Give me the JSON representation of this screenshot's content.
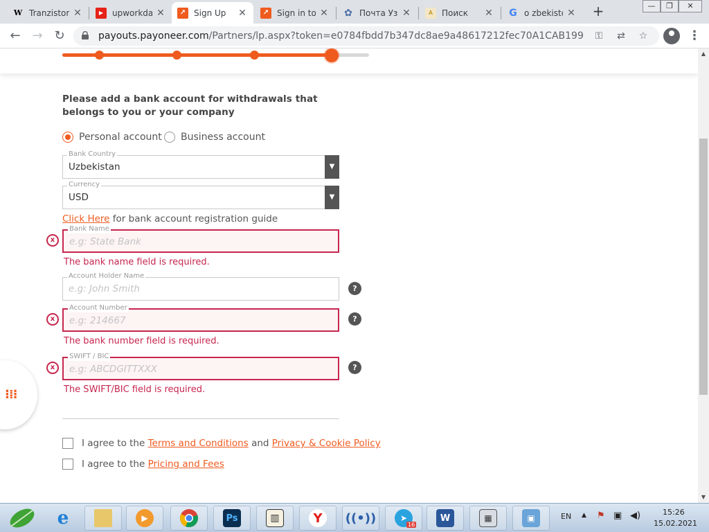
{
  "browser": {
    "tabs": [
      {
        "title": "Tranzistor",
        "favicon": "wikipedia-icon",
        "favicon_text": "W"
      },
      {
        "title": "upworkda",
        "favicon": "youtube-icon",
        "favicon_text": "▶"
      },
      {
        "title": "Sign Up",
        "favicon": "payoneer-icon",
        "favicon_text": "↗"
      },
      {
        "title": "Sign in to",
        "favicon": "payoneer-icon",
        "favicon_text": "↗"
      },
      {
        "title": "Почта Узб",
        "favicon": "settings-gear-icon",
        "favicon_text": "✿"
      },
      {
        "title": "Поиск",
        "favicon": "search-page-icon",
        "favicon_text": "A"
      },
      {
        "title": "o zbekisto",
        "favicon": "google-icon",
        "favicon_text": "G"
      }
    ],
    "new_tab": "+",
    "url_host": "payouts.payoneer.com",
    "url_rest": "/Partners/lp.aspx?token=e0784fbdd7b347dc8ae9a48617212fec70A1CAB199"
  },
  "progress": {
    "steps_total": 4,
    "current_step": 4
  },
  "form": {
    "heading": "Please add a bank account for withdrawals that belongs to you or your company",
    "account_types": [
      {
        "label": "Personal account",
        "checked": true
      },
      {
        "label": "Business account",
        "checked": false
      }
    ],
    "bank_country": {
      "label": "Bank Country",
      "value": "Uzbekistan"
    },
    "currency": {
      "label": "Currency",
      "value": "USD"
    },
    "guide_link": "Click Here",
    "guide_text": " for bank account registration guide",
    "bank_name": {
      "label": "Bank Name",
      "placeholder": "e.g: State Bank",
      "error": "The bank name field is required."
    },
    "account_holder": {
      "label": "Account Holder Name",
      "placeholder": "e.g: John Smith"
    },
    "account_number": {
      "label": "Account Number",
      "placeholder": "e.g: 214667",
      "error": "The bank number field is required."
    },
    "swift": {
      "label": "SWIFT / BIC",
      "placeholder": "e.g: ABCDGITTXXX",
      "error": "The SWIFT/BIC field is required."
    },
    "help_mark": "?",
    "error_mark": "x",
    "agree_terms": {
      "prefix": "I agree to the ",
      "link1": "Terms and Conditions",
      "middle": " and ",
      "link2": "Privacy & Cookie Policy"
    },
    "agree_fees": {
      "prefix": "I agree to the ",
      "link1": "Pricing and Fees"
    }
  },
  "taskbar": {
    "apps": [
      "start-orb",
      "internet-explorer-icon",
      "file-explorer-icon",
      "media-player-icon",
      "chrome-icon",
      "photoshop-icon",
      "dictionary-icon",
      "yandex-icon",
      "wifi-tool-icon",
      "telegram-icon",
      "word-icon",
      "calculator-icon",
      "control-panel-icon"
    ],
    "photoshop_label": "Ps",
    "yandex_label": "Y",
    "word_label": "W",
    "telegram_badge": "16",
    "language": "EN",
    "time": "15:26",
    "date": "15.02.2021"
  },
  "colors": {
    "accent": "#ef5b1f",
    "error": "#c7254e"
  }
}
